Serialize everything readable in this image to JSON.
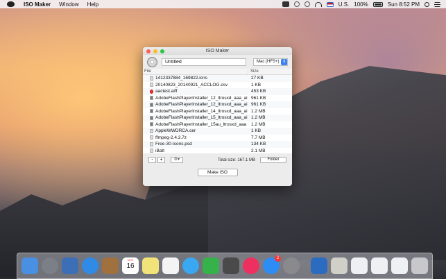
{
  "menubar": {
    "app_name": "ISO Maker",
    "menus": [
      "Window",
      "Help"
    ],
    "input_source": "U.S.",
    "battery": "100%",
    "clock": "Sun 8:52 PM"
  },
  "window": {
    "title": "ISO Maker",
    "name_value": "Untitled",
    "format_value": "Mac (HFS+)",
    "columns": {
      "file": "File",
      "size": "Size"
    },
    "files": [
      {
        "name": "1412337884_169822.icns",
        "size": "27 KB",
        "icon": "file"
      },
      {
        "name": "20140823_20140921_ACCLOG.csv",
        "size": "1 KB",
        "icon": "file"
      },
      {
        "name": "aactest.aiff",
        "size": "453 KB",
        "icon": "audio"
      },
      {
        "name": "AdobeFlashPlayerInstaller_12_ltrosxd_aaa_ai",
        "size": "961 KB",
        "icon": "lock"
      },
      {
        "name": "AdobeFlashPlayerInstaller_12_ltrosxd_aaa_ai",
        "size": "961 KB",
        "icon": "lock"
      },
      {
        "name": "AdobeFlashPlayerInstaller_14_ltrosxd_aaa_ai",
        "size": "1.2 MB",
        "icon": "lock"
      },
      {
        "name": "AdobeFlashPlayerInstaller_15_ltrosxd_aaa_ai",
        "size": "1.2 MB",
        "icon": "lock"
      },
      {
        "name": "AdobeFlashPlayerInstaller_15au_ltrosxd_aaa",
        "size": "1.2 MB",
        "icon": "lock"
      },
      {
        "name": "AppleWWDRCA.cer",
        "size": "1 KB",
        "icon": "file"
      },
      {
        "name": "ffmpeg-2.4.3.7z",
        "size": "7.7 MB",
        "icon": "file"
      },
      {
        "name": "Free-30-Icons.psd",
        "size": "134 KB",
        "icon": "file"
      },
      {
        "name": "iBatt",
        "size": "2.1 MB",
        "icon": "file"
      }
    ],
    "remove_label": "-",
    "add_label": "+",
    "gear_label": "⚙▾",
    "total_size": "Total size: 167.1 MB",
    "folder_label": "Folder",
    "make_iso_label": "Make ISO"
  },
  "dock": {
    "calendar_day": "16",
    "calendar_month": "NOV",
    "app_store_badge": "2",
    "apps": [
      "finder",
      "launchpad",
      "preview",
      "safari",
      "contacts",
      "calendar",
      "notes",
      "reminders",
      "messages",
      "facetime",
      "photo-booth",
      "itunes",
      "app-store",
      "system-preferences",
      "xcode",
      "file-merge"
    ],
    "colors": [
      "#4a90e2",
      "#7a7f88",
      "#3c6fb5",
      "#2f8be6",
      "#a0703e",
      "#ffffff",
      "#f2e27a",
      "#f4f4f4",
      "#3aa7f2",
      "#36b24a",
      "#4a4a4a",
      "#ee3060",
      "#2e8df5",
      "#8a8a8e",
      "#2b6cc0",
      "#d0cfc8"
    ]
  }
}
